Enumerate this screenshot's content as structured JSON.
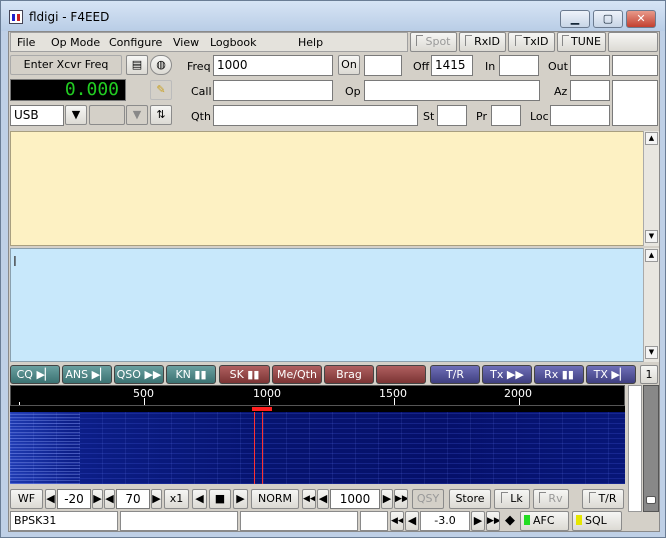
{
  "window": {
    "title": "fldigi - F4EED",
    "min": "▁",
    "max": "▢",
    "close": "✕"
  },
  "menu": {
    "items": [
      "File",
      "Op Mode",
      "Configure",
      "View",
      "Logbook",
      "Help"
    ]
  },
  "top_toggles": {
    "spot": "Spot",
    "rxid": "RxID",
    "txid": "TxID",
    "tune": "TUNE"
  },
  "xcvr": {
    "enter_label": "Enter Xcvr Freq",
    "freq_display": "0.000",
    "mode": "USB"
  },
  "log": {
    "freq_label": "Freq",
    "freq": "1000",
    "on_label": "On",
    "on": "",
    "off_label": "Off",
    "off": "1415",
    "in_label": "In",
    "in": "",
    "out_label": "Out",
    "out": "",
    "call_label": "Call",
    "call": "",
    "op_label": "Op",
    "op": "",
    "az_label": "Az",
    "az": "",
    "qth_label": "Qth",
    "qth": "",
    "st_label": "St",
    "st": "",
    "pr_label": "Pr",
    "pr": "",
    "loc_label": "Loc",
    "loc": ""
  },
  "macros": [
    {
      "label": "CQ",
      "glyph": "▶▏"
    },
    {
      "label": "ANS",
      "glyph": "▶▏"
    },
    {
      "label": "QSO",
      "glyph": "▶▶"
    },
    {
      "label": "KN",
      "glyph": "▮▮"
    },
    {
      "label": "SK",
      "glyph": "▮▮"
    },
    {
      "label": "Me/Qth",
      "glyph": ""
    },
    {
      "label": "Brag",
      "glyph": ""
    },
    {
      "label": "",
      "glyph": ""
    },
    {
      "label": "T/R",
      "glyph": ""
    },
    {
      "label": "Tx",
      "glyph": "▶▶"
    },
    {
      "label": "Rx",
      "glyph": "▮▮"
    },
    {
      "label": "TX",
      "glyph": "▶▏"
    }
  ],
  "macro_page": "1",
  "scale": {
    "labels": [
      "500",
      "1000",
      "1500",
      "2000"
    ]
  },
  "waterfall_controls": {
    "wf": "WF",
    "level": "-20",
    "range": "70",
    "zoom": "x1",
    "norm": "NORM",
    "freq": "1000",
    "qsy": "QSY",
    "store": "Store",
    "lk": "Lk",
    "rv": "Rv",
    "tr": "T/R"
  },
  "status": {
    "mode": "BPSK31",
    "snr": "-3.0",
    "afc": "AFC",
    "sql": "SQL"
  },
  "colors": {
    "rx_bg": "#fdf1c3",
    "tx_bg": "#c8e8fb",
    "freq_digits": "#22cc22",
    "cursor": "#ff2020",
    "afc_light": "#22dd22",
    "sql_light": "#e6e600"
  }
}
